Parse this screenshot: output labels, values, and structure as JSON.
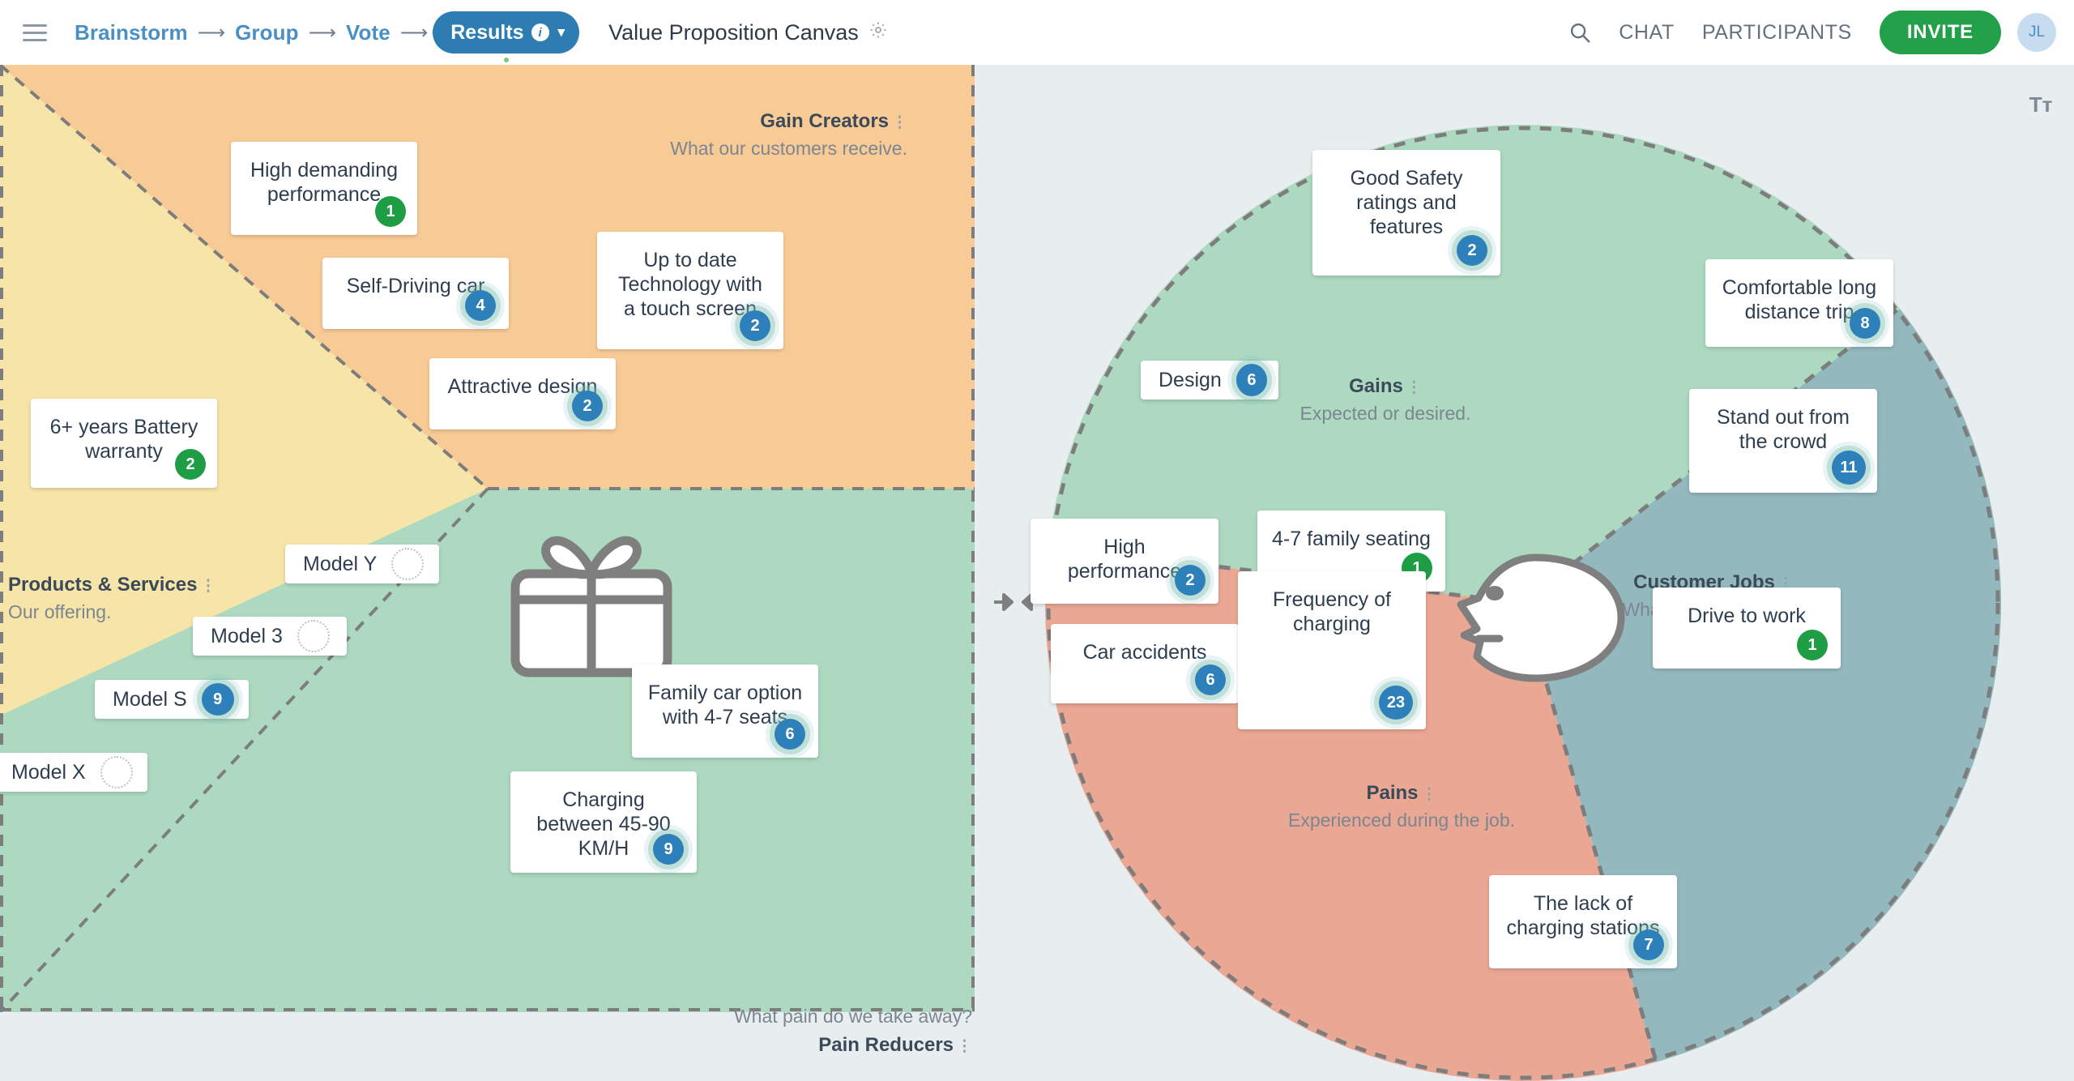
{
  "header": {
    "menu_icon": "hamburger-icon",
    "breadcrumb": [
      "Brainstorm",
      "Group",
      "Vote"
    ],
    "arrow_glyph": "⟶",
    "results_label": "Results",
    "results_info": "i",
    "results_chevron": "⌄",
    "canvas_title": "Value Proposition Canvas",
    "gear_icon": "⚙",
    "search_icon": "search-icon",
    "chat_label": "CHAT",
    "participants_label": "PARTICIPANTS",
    "invite_label": "INVITE",
    "avatar_initials": "JL",
    "colors": {
      "accent_blue": "#2e7db2",
      "link_blue": "#4a90c4",
      "invite_green": "#22a04a"
    }
  },
  "toolbar": {
    "text_format_label": "Tᴛ"
  },
  "value_map": {
    "gain_creators": {
      "title": "Gain Creators",
      "subtitle": "What our customers receive.",
      "kebab": "⋮",
      "cards": [
        {
          "text": "High demanding performance",
          "votes": "1",
          "vote_color": "green"
        },
        {
          "text": "Self-Driving car",
          "votes": "4",
          "vote_color": "blue"
        },
        {
          "text": "Up to date Technology with a touch screen",
          "votes": "2",
          "vote_color": "blue"
        },
        {
          "text": "Attractive design",
          "votes": "2",
          "vote_color": "blue"
        },
        {
          "text": "6+ years Battery warranty",
          "votes": "2",
          "vote_color": "green"
        }
      ]
    },
    "products_services": {
      "title": "Products & Services",
      "subtitle": "Our offering.",
      "kebab": "⋮",
      "cards": [
        {
          "text": "Model Y",
          "votes": "",
          "vote_color": "empty"
        },
        {
          "text": "Model 3",
          "votes": "",
          "vote_color": "empty"
        },
        {
          "text": "Model S",
          "votes": "9",
          "vote_color": "blue"
        },
        {
          "text": "Model X",
          "votes": "",
          "vote_color": "empty"
        }
      ]
    },
    "pain_reducers": {
      "title": "Pain Reducers",
      "subtitle": "What pain do we take away?",
      "kebab": "⋮",
      "cards": [
        {
          "text": "Family car option with 4-7 seats",
          "votes": "6",
          "vote_color": "blue"
        },
        {
          "text": "Charging between 45-90 KM/H",
          "votes": "9",
          "vote_color": "blue"
        }
      ]
    }
  },
  "customer_profile": {
    "gains": {
      "title": "Gains",
      "subtitle": "Expected or desired.",
      "kebab": "⋮",
      "cards": [
        {
          "text": "Good Safety ratings and features",
          "votes": "2",
          "vote_color": "blue"
        },
        {
          "text": "Design",
          "votes": "6",
          "vote_color": "blue"
        },
        {
          "text": "High performance",
          "votes": "2",
          "vote_color": "blue"
        },
        {
          "text": "4-7 family seating",
          "votes": "1",
          "vote_color": "green"
        }
      ]
    },
    "customer_jobs": {
      "title": "Customer Jobs",
      "subtitle": "What they need to do.",
      "kebab": "⋮",
      "cards": [
        {
          "text": "Comfortable long distance trip",
          "votes": "8",
          "vote_color": "blue"
        },
        {
          "text": "Stand out from the crowd",
          "votes": "11",
          "vote_color": "blue"
        },
        {
          "text": "Drive to work",
          "votes": "1",
          "vote_color": "green"
        }
      ]
    },
    "pains": {
      "title": "Pains",
      "subtitle": "Experienced during the job.",
      "kebab": "⋮",
      "cards": [
        {
          "text": "Car accidents",
          "votes": "6",
          "vote_color": "blue"
        },
        {
          "text": "Frequency of charging",
          "votes": "23",
          "vote_color": "blue"
        },
        {
          "text": "The lack of charging stations",
          "votes": "7",
          "vote_color": "blue"
        }
      ]
    }
  },
  "colors": {
    "gain_creators_bg": "#f8cb96",
    "products_bg": "#f7e4a8",
    "pain_reducers_bg": "#add9c0",
    "gains_bg": "#add9c0",
    "jobs_bg": "#93b8bd",
    "pains_bg": "#eaa794",
    "board_bg": "#e8edef"
  }
}
